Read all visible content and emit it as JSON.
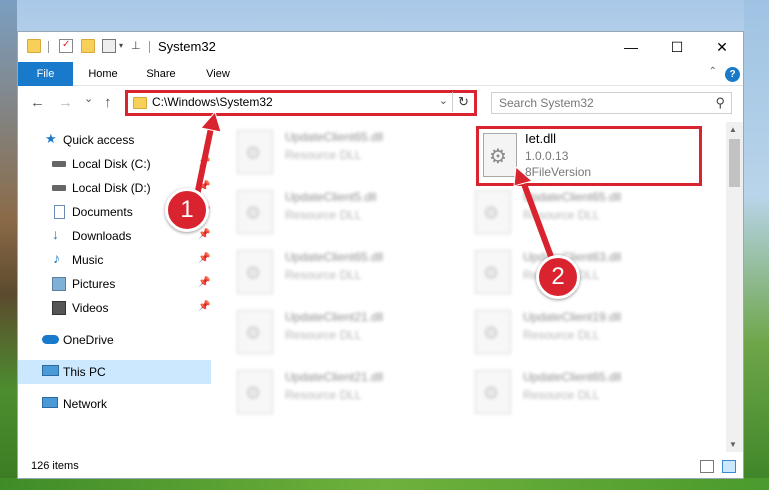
{
  "window": {
    "title": "System32",
    "controls": {
      "minimize": "—",
      "maximize": "☐",
      "close": "✕"
    }
  },
  "ribbon": {
    "tabs": [
      "File",
      "Home",
      "Share",
      "View"
    ],
    "help": "?",
    "collapse": "⌃"
  },
  "nav": {
    "back": "←",
    "forward": "→",
    "recent": "⌄",
    "up": "↑",
    "address": "C:\\Windows\\System32",
    "address_dropdown": "⌄",
    "refresh": "↻",
    "search_placeholder": "Search System32",
    "search_icon": "⚲"
  },
  "sidebar": {
    "items": [
      {
        "label": "Quick access",
        "icon": "star-icon",
        "pinned": false
      },
      {
        "label": "Local Disk (C:)",
        "icon": "drive-icon",
        "pinned": true
      },
      {
        "label": "Local Disk (D:)",
        "icon": "drive-icon",
        "pinned": true
      },
      {
        "label": "Documents",
        "icon": "documents-icon",
        "pinned": true
      },
      {
        "label": "Downloads",
        "icon": "downloads-icon",
        "pinned": true
      },
      {
        "label": "Music",
        "icon": "music-icon",
        "pinned": true
      },
      {
        "label": "Pictures",
        "icon": "pictures-icon",
        "pinned": true
      },
      {
        "label": "Videos",
        "icon": "videos-icon",
        "pinned": true
      },
      {
        "label": "OneDrive",
        "icon": "cloud-icon",
        "pinned": false
      },
      {
        "label": "This PC",
        "icon": "computer-icon",
        "pinned": false,
        "selected": true
      },
      {
        "label": "Network",
        "icon": "network-icon",
        "pinned": false
      }
    ]
  },
  "files": [
    {
      "name": "UpdateClient65.dll",
      "desc": "Resource DLL"
    },
    {
      "name": "UpdateClient5.dll",
      "desc": "Resource DLL"
    },
    {
      "name": "UpdateClient65.dll",
      "desc": "Resource DLL"
    },
    {
      "name": "UpdateClient65.dll",
      "desc": "Resource DLL"
    },
    {
      "name": "UpdateClient65.dll",
      "desc": "Resource DLL"
    },
    {
      "name": "UpdateClient63.dll",
      "desc": "Resource DLL"
    },
    {
      "name": "UpdateClient21.dll",
      "desc": "Resource DLL"
    },
    {
      "name": "UpdateClient19.dll",
      "desc": "Resource DLL"
    },
    {
      "name": "UpdateClient21.dll",
      "desc": "Resource DLL"
    },
    {
      "name": "UpdateClient65.dll",
      "desc": "Resource DLL"
    }
  ],
  "highlighted_file": {
    "name": "Iet.dll",
    "version": "1.0.0.13",
    "description": "8FileVersion"
  },
  "status": {
    "count": "126 items"
  },
  "callouts": [
    "1",
    "2"
  ],
  "colors": {
    "accent": "#1979ca",
    "highlight": "#d9232e",
    "selected": "#cce8ff"
  }
}
